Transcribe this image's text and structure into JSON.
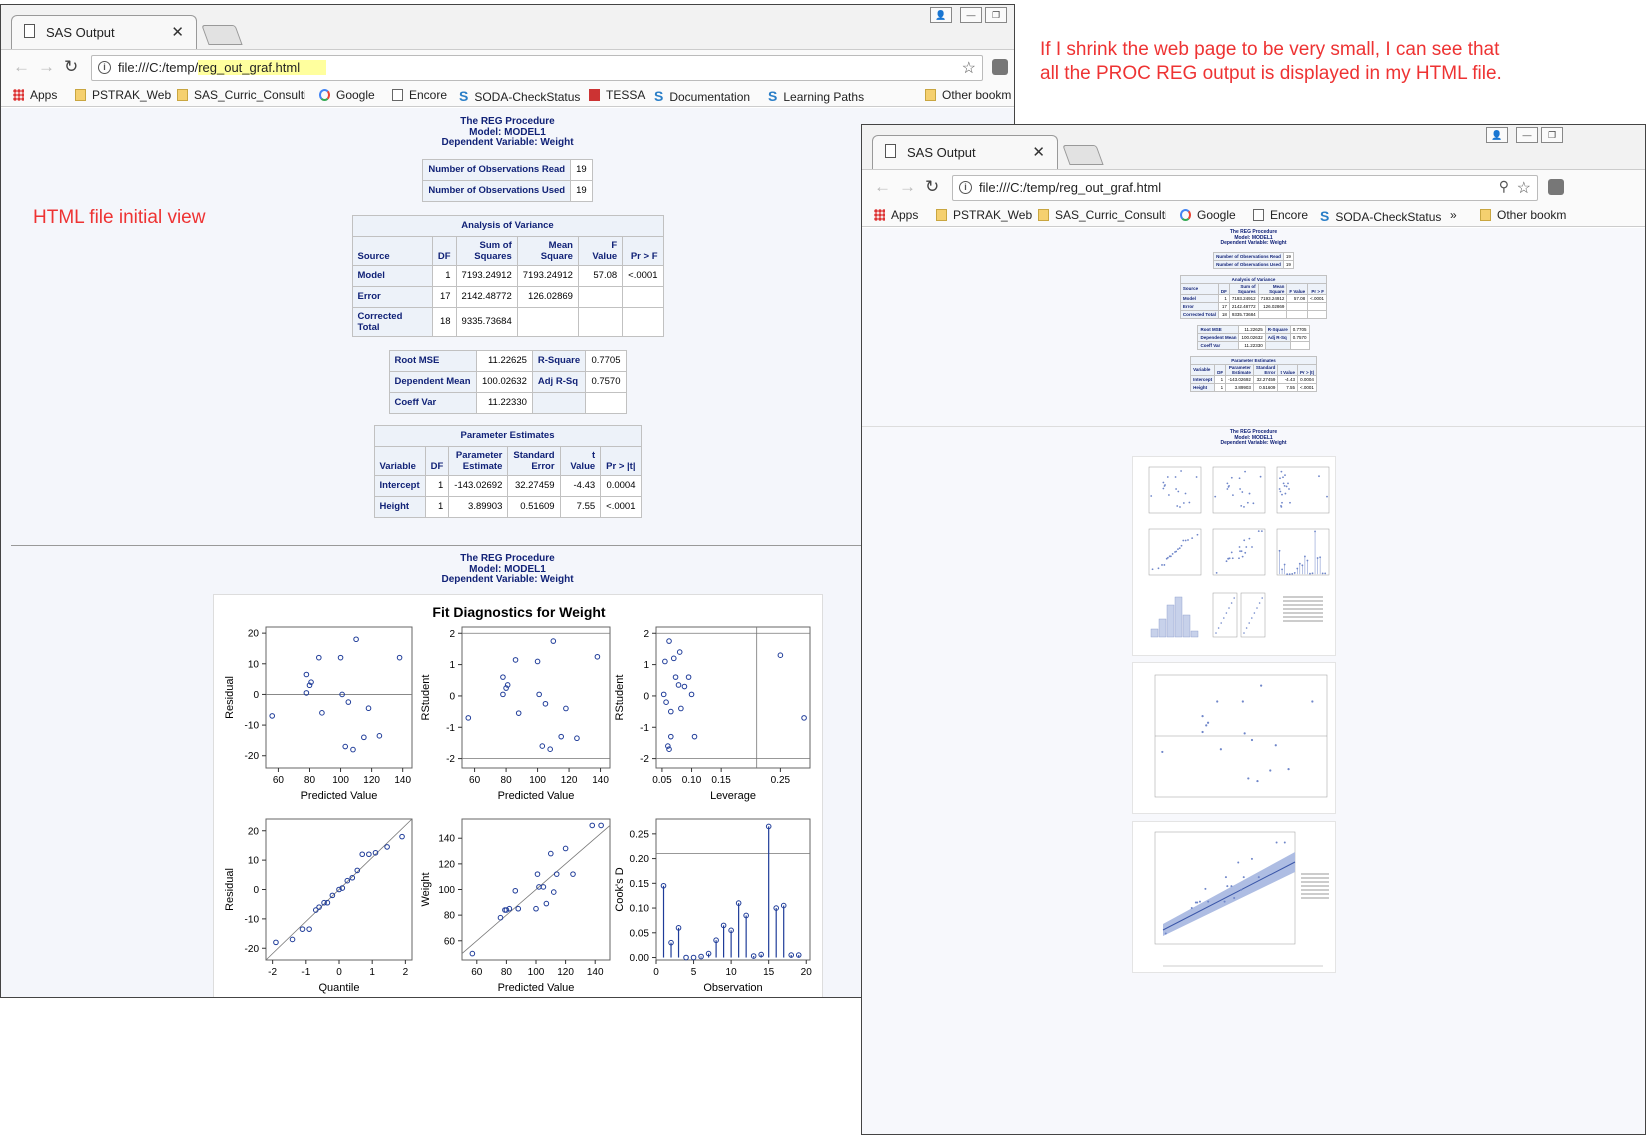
{
  "annotations": {
    "top_right_line1": "If I shrink the web page to be very small, I can see that",
    "top_right_line2": "all the PROC REG output is displayed in my HTML file.",
    "initial_view": "HTML file initial view"
  },
  "browser": {
    "tab_title": "SAS Output",
    "url_prefix": "file:///C:/temp/",
    "url_highlight": "reg_out_graf.html",
    "url_full": "file:///C:/temp/reg_out_graf.html",
    "bookmarks": [
      "Apps",
      "PSTRAK_Web",
      "SAS_Curric_Consultin",
      "Google",
      "Encore",
      "SODA-CheckStatus",
      "TESSA",
      "Documentation",
      "Learning Paths",
      "Other bookm"
    ],
    "bookmarks_small": [
      "Apps",
      "PSTRAK_Web",
      "SAS_Curric_Consultin",
      "Google",
      "Encore",
      "SODA-CheckStatus",
      "»",
      "Other bookm"
    ]
  },
  "sas": {
    "title1": "The REG Procedure",
    "title2": "Model: MODEL1",
    "title3": "Dependent Variable: Weight",
    "nobs": {
      "read_label": "Number of Observations Read",
      "read": "19",
      "used_label": "Number of Observations Used",
      "used": "19"
    },
    "anova": {
      "caption": "Analysis of Variance",
      "h_source": "Source",
      "h_df": "DF",
      "h_ss1": "Sum of",
      "h_ss2": "Squares",
      "h_ms1": "Mean",
      "h_ms2": "Square",
      "h_f": "F Value",
      "h_p": "Pr > F",
      "rows": [
        {
          "source": "Model",
          "df": "1",
          "ss": "7193.24912",
          "ms": "7193.24912",
          "f": "57.08",
          "p": "<.0001"
        },
        {
          "source": "Error",
          "df": "17",
          "ss": "2142.48772",
          "ms": "126.02869",
          "f": "",
          "p": ""
        },
        {
          "source": "Corrected Total",
          "df": "18",
          "ss": "9335.73684",
          "ms": "",
          "f": "",
          "p": ""
        }
      ]
    },
    "fit": {
      "root_mse_label": "Root MSE",
      "root_mse": "11.22625",
      "rsq_label": "R-Square",
      "rsq": "0.7705",
      "dep_mean_label": "Dependent Mean",
      "dep_mean": "100.02632",
      "adj_rsq_label": "Adj R-Sq",
      "adj_rsq": "0.7570",
      "cv_label": "Coeff Var",
      "cv": "11.22330"
    },
    "params": {
      "caption": "Parameter Estimates",
      "h_var": "Variable",
      "h_df": "DF",
      "h_est1": "Parameter",
      "h_est2": "Estimate",
      "h_se1": "Standard",
      "h_se2": "Error",
      "h_t": "t Value",
      "h_p": "Pr > |t|",
      "rows": [
        {
          "var": "Intercept",
          "df": "1",
          "est": "-143.02692",
          "se": "32.27459",
          "t": "-4.43",
          "p": "0.0004"
        },
        {
          "var": "Height",
          "df": "1",
          "est": "3.89903",
          "se": "0.51609",
          "t": "7.55",
          "p": "<.0001"
        }
      ]
    },
    "diag_title": "Fit Diagnostics for Weight"
  },
  "chart_data": [
    {
      "type": "scatter",
      "xlabel": "Predicted Value",
      "ylabel": "Residual",
      "xlim": [
        52,
        146
      ],
      "ylim": [
        -24,
        22
      ],
      "xticks": [
        60,
        80,
        100,
        120,
        140
      ],
      "yticks": [
        -20,
        -10,
        0,
        10,
        20
      ],
      "hlines": [
        0
      ],
      "x": [
        56,
        78,
        78,
        80,
        81,
        86,
        88,
        100,
        101,
        103,
        105,
        108,
        110,
        115,
        118,
        125,
        138
      ],
      "y": [
        -7,
        0.5,
        6.5,
        3,
        4,
        12,
        -6,
        12,
        0,
        -17,
        -2.5,
        -18,
        18,
        -14,
        -4.5,
        -13.5,
        12
      ]
    },
    {
      "type": "scatter",
      "xlabel": "Predicted Value",
      "ylabel": "RStudent",
      "xlim": [
        52,
        146
      ],
      "ylim": [
        -2.3,
        2.2
      ],
      "xticks": [
        60,
        80,
        100,
        120,
        140
      ],
      "yticks": [
        -2,
        -1,
        0,
        1,
        2
      ],
      "hlines": [
        -2,
        2
      ],
      "x": [
        56,
        78,
        78,
        80,
        81,
        86,
        88,
        100,
        101,
        103,
        105,
        108,
        110,
        115,
        118,
        125,
        138
      ],
      "y": [
        -0.7,
        0.05,
        0.6,
        0.25,
        0.35,
        1.15,
        -0.55,
        1.1,
        0.05,
        -1.6,
        -0.25,
        -1.7,
        1.75,
        -1.3,
        -0.4,
        -1.35,
        1.25
      ]
    },
    {
      "type": "scatter",
      "xlabel": "Leverage",
      "ylabel": "RStudent",
      "xlim": [
        0.04,
        0.3
      ],
      "ylim": [
        -2.3,
        2.2
      ],
      "xticks": [
        0.05,
        0.1,
        0.15,
        0.25
      ],
      "xtick_labels": [
        "0.05",
        "0.10",
        "0.15",
        "0.25"
      ],
      "yticks": [
        -2,
        -1,
        0,
        1,
        2
      ],
      "hlines": [
        -2,
        2
      ],
      "vlines": [
        0.21
      ],
      "x": [
        0.053,
        0.055,
        0.057,
        0.06,
        0.062,
        0.065,
        0.07,
        0.073,
        0.078,
        0.08,
        0.082,
        0.088,
        0.095,
        0.1,
        0.105,
        0.065,
        0.062,
        0.25,
        0.29
      ],
      "y": [
        0.05,
        1.1,
        -0.2,
        -1.6,
        1.75,
        -0.5,
        1.2,
        0.6,
        0.35,
        1.4,
        -0.4,
        0.3,
        0.6,
        0.05,
        -1.3,
        -1.3,
        -1.7,
        1.3,
        -0.7
      ]
    },
    {
      "type": "scatter",
      "xlabel": "Quantile",
      "ylabel": "Residual",
      "xlim": [
        -2.2,
        2.2
      ],
      "ylim": [
        -24,
        24
      ],
      "xticks": [
        -2,
        -1,
        0,
        1,
        2
      ],
      "yticks": [
        -20,
        -10,
        0,
        10,
        20
      ],
      "ref_line": [
        [
          -2.2,
          -24
        ],
        [
          2.2,
          24
        ]
      ],
      "x": [
        -1.9,
        -1.4,
        -1.1,
        -0.9,
        -0.7,
        -0.6,
        -0.45,
        -0.35,
        -0.2,
        0,
        0.1,
        0.25,
        0.4,
        0.55,
        0.7,
        0.9,
        1.1,
        1.45,
        1.9
      ],
      "y": [
        -18,
        -17,
        -13.5,
        -13.5,
        -7,
        -6,
        -4.5,
        -4.5,
        -2,
        0,
        0.5,
        3,
        4,
        6.5,
        12,
        12,
        12.5,
        14.5,
        18
      ]
    },
    {
      "type": "scatter",
      "xlabel": "Predicted Value",
      "ylabel": "Weight",
      "xlim": [
        50,
        150
      ],
      "ylim": [
        45,
        155
      ],
      "xticks": [
        60,
        80,
        100,
        120,
        140
      ],
      "yticks": [
        60,
        80,
        100,
        120,
        140
      ],
      "ref_line": [
        [
          50,
          50
        ],
        [
          150,
          150
        ]
      ],
      "x": [
        57,
        76,
        79,
        80,
        82,
        86,
        88,
        100,
        101,
        102,
        105,
        107,
        110,
        112,
        114,
        120,
        125,
        138,
        144
      ],
      "y": [
        50,
        78,
        84,
        84,
        85,
        99,
        85,
        85,
        112,
        102,
        102,
        89,
        128,
        98,
        112,
        132,
        112,
        150,
        150
      ]
    },
    {
      "type": "bar",
      "xlabel": "Observation",
      "ylabel": "Cook's D",
      "xlim": [
        0,
        20.5
      ],
      "ylim": [
        -0.005,
        0.28
      ],
      "xticks": [
        0,
        5,
        10,
        15,
        20
      ],
      "yticks": [
        0,
        0.05,
        0.1,
        0.15,
        0.2,
        0.25
      ],
      "ytick_labels": [
        "0.00",
        "0.05",
        "0.10",
        "0.15",
        "0.20",
        "0.25"
      ],
      "hlines": [
        0.21
      ],
      "x": [
        1,
        2,
        3,
        4,
        5,
        6,
        7,
        8,
        9,
        10,
        11,
        12,
        13,
        14,
        15,
        16,
        17,
        18,
        19
      ],
      "y": [
        0.145,
        0.03,
        0.06,
        0.0,
        0.0,
        0.002,
        0.008,
        0.035,
        0.065,
        0.055,
        0.11,
        0.085,
        0.003,
        0.006,
        0.265,
        0.1,
        0.105,
        0.005,
        0.005
      ]
    }
  ],
  "colors": {
    "sas_text": "#112277",
    "marker": "#1f3c99",
    "annot": "#ee3333"
  }
}
